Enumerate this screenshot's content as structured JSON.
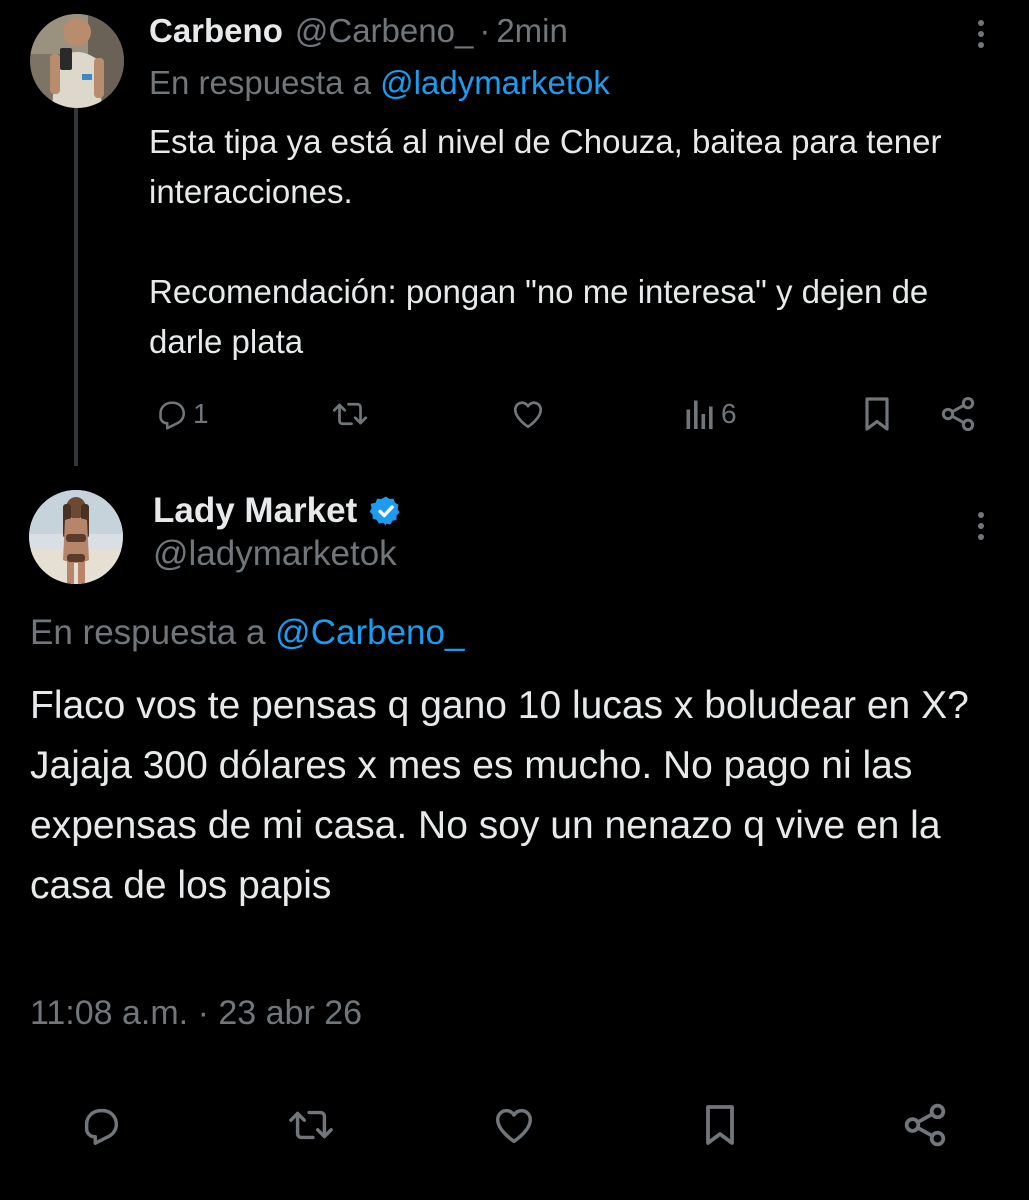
{
  "reply_tweet": {
    "display_name": "Carbeno",
    "handle": "@Carbeno_",
    "separator": "·",
    "time_ago": "2min",
    "reply_prefix": "En respuesta a",
    "reply_mention": "@ladymarketok",
    "body": [
      "Esta tipa ya está al nivel de Chouza, baitea para tener interacciones.",
      "Recomendación: pongan \"no me interesa\" y dejen de darle plata"
    ],
    "actions": {
      "reply_count": "1",
      "views_count": "6"
    },
    "icons": [
      "reply-icon",
      "retweet-icon",
      "like-icon",
      "views-icon",
      "bookmark-icon",
      "share-icon",
      "more-icon"
    ]
  },
  "main_tweet": {
    "display_name": "Lady Market",
    "verified": true,
    "handle": "@ladymarketok",
    "reply_prefix": "En respuesta a",
    "reply_mention": "@Carbeno_",
    "body": "Flaco vos te pensas q gano 10 lucas x boludear en X? Jajaja 300 dólares x mes es mucho. No pago ni las expensas de mi casa. No soy un nenazo q vive en la casa de los papis",
    "time": "11:08 a.m.",
    "separator": "·",
    "date": "23 abr 26",
    "icons": [
      "reply-icon",
      "retweet-icon",
      "like-icon",
      "bookmark-icon",
      "share-icon",
      "more-icon"
    ]
  },
  "colors": {
    "background": "#000000",
    "text": "#e7e9ea",
    "muted": "#71767b",
    "link": "#1d9bf0",
    "thread_line": "#333639",
    "verified_badge": "#1d9bf0"
  }
}
